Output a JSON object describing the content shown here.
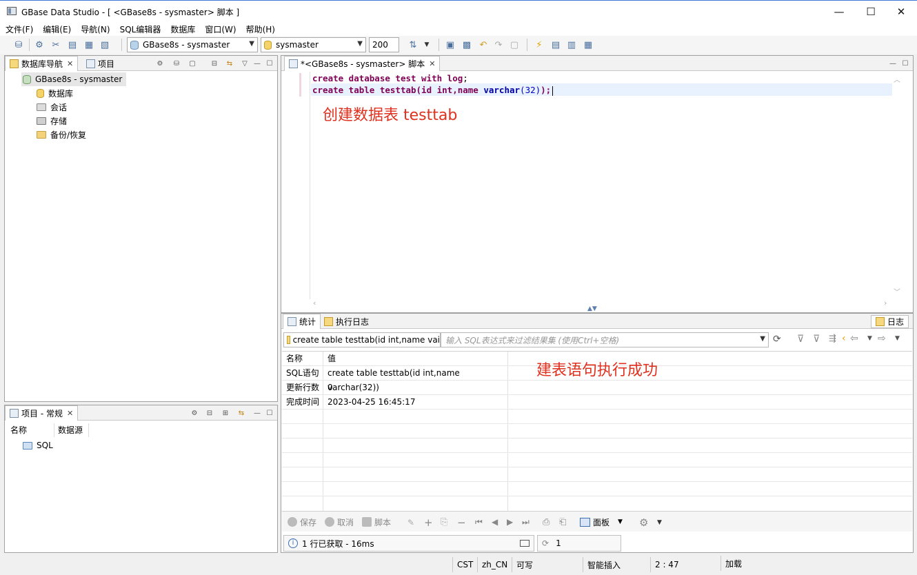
{
  "window": {
    "title": "GBase Data Studio - [ <GBase8s - sysmaster> 脚本 ]",
    "controls": [
      "—",
      "☐",
      "✕"
    ]
  },
  "menu": [
    "文件(F)",
    "编辑(E)",
    "导航(N)",
    "SQL编辑器",
    "数据库",
    "窗口(W)",
    "帮助(H)"
  ],
  "toolbar": {
    "connection": "GBase8s - sysmaster",
    "database": "sysmaster",
    "limit": "200"
  },
  "navigator": {
    "tabs": [
      {
        "label": "数据库导航",
        "close": "✕"
      },
      {
        "label": "项目"
      }
    ],
    "root": "GBase8s - sysmaster",
    "children": [
      "数据库",
      "会话",
      "存储",
      "备份/恢复"
    ]
  },
  "project": {
    "tab": "项目 - 常规",
    "close": "✕",
    "columns": [
      "名称",
      "数据源"
    ],
    "items": [
      "SQL"
    ]
  },
  "editor": {
    "tab": "*<GBase8s - sysmaster> 脚本",
    "close": "✕",
    "line1": {
      "kw1": "create database",
      "rest": " test ",
      "kw2": "with log",
      "end": ";"
    },
    "line2": {
      "kw1": "create table",
      "rest": " testtab(id int,name ",
      "kw2": "varchar",
      "num": "(32)",
      "end": ");"
    },
    "annotation": "创建数据表 testtab"
  },
  "results": {
    "tabs": [
      "统计",
      "执行日志"
    ],
    "log_button": "日志",
    "query_text": "create table testtab(id int,name vai",
    "filter_placeholder": "输入 SQL表达式来过滤结果集 (使用Ctrl+空格)",
    "headers": [
      "名称",
      "值"
    ],
    "rows": [
      [
        "SQL语句",
        "create table testtab(id int,name varchar(32))"
      ],
      [
        "更新行数",
        "0"
      ],
      [
        "完成时间",
        "2023-04-25 16:45:17"
      ]
    ],
    "annotation": "建表语句执行成功",
    "buttons": {
      "save": "保存",
      "cancel": "取消",
      "script": "脚本",
      "panel": "面板"
    },
    "status": "1 行已获取 - 16ms",
    "fetch_count": "1"
  },
  "statusbar": {
    "tz": "CST",
    "locale": "zh_CN",
    "mode": "可写",
    "insert": "智能插入",
    "position": "2 : 47",
    "loading": "加载"
  }
}
